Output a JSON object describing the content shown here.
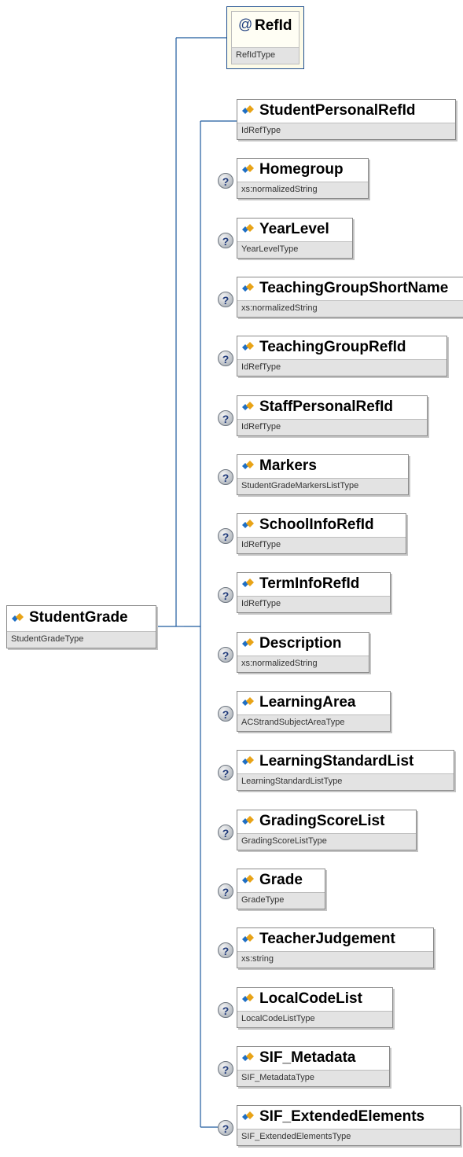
{
  "root": {
    "name": "StudentGrade",
    "type": "StudentGradeType"
  },
  "attribute": {
    "name": "RefId",
    "type": "RefIdType"
  },
  "elements": [
    {
      "name": "StudentPersonalRefId",
      "type": "IdRefType",
      "optional": false
    },
    {
      "name": "Homegroup",
      "type": "xs:normalizedString",
      "optional": true
    },
    {
      "name": "YearLevel",
      "type": "YearLevelType",
      "optional": true
    },
    {
      "name": "TeachingGroupShortName",
      "type": "xs:normalizedString",
      "optional": true
    },
    {
      "name": "TeachingGroupRefId",
      "type": "IdRefType",
      "optional": true
    },
    {
      "name": "StaffPersonalRefId",
      "type": "IdRefType",
      "optional": true
    },
    {
      "name": "Markers",
      "type": "StudentGradeMarkersListType",
      "optional": true
    },
    {
      "name": "SchoolInfoRefId",
      "type": "IdRefType",
      "optional": true
    },
    {
      "name": "TermInfoRefId",
      "type": "IdRefType",
      "optional": true
    },
    {
      "name": "Description",
      "type": "xs:normalizedString",
      "optional": true
    },
    {
      "name": "LearningArea",
      "type": "ACStrandSubjectAreaType",
      "optional": true
    },
    {
      "name": "LearningStandardList",
      "type": "LearningStandardListType",
      "optional": true
    },
    {
      "name": "GradingScoreList",
      "type": "GradingScoreListType",
      "optional": true
    },
    {
      "name": "Grade",
      "type": "GradeType",
      "optional": true
    },
    {
      "name": "TeacherJudgement",
      "type": "xs:string",
      "optional": true
    },
    {
      "name": "LocalCodeList",
      "type": "LocalCodeListType",
      "optional": true
    },
    {
      "name": "SIF_Metadata",
      "type": "SIF_MetadataType",
      "optional": true
    },
    {
      "name": "SIF_ExtendedElements",
      "type": "SIF_ExtendedElementsType",
      "optional": true
    }
  ],
  "icons": {
    "element": "element-diamond-icon",
    "optional": "question-mark-icon",
    "attribute": "at-sign-icon"
  },
  "colors": {
    "line": "#1f5a9e",
    "type_band": "#e3e3e3",
    "attribute_border": "#1f4f8f",
    "icon_orange": "#e8a317",
    "icon_blue": "#1f6fc4"
  }
}
